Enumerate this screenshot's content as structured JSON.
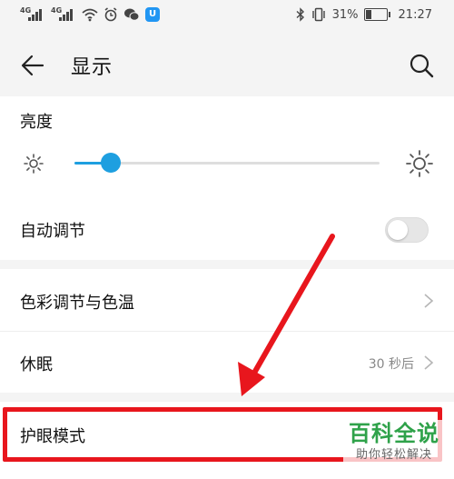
{
  "status_bar": {
    "network_1": "4G",
    "network_2": "4G",
    "battery_percent_text": "31%",
    "battery_level": 0.31,
    "time": "21:27",
    "badge": "U",
    "icons": [
      "signal-icon",
      "wifi-icon",
      "alarm-icon",
      "wechat-icon",
      "bluetooth-icon",
      "vibrate-icon",
      "battery-icon"
    ]
  },
  "header": {
    "title": "显示",
    "back_icon": "arrow-left-icon",
    "search_icon": "search-icon"
  },
  "brightness": {
    "label": "亮度",
    "level": 0.12,
    "icons": [
      "sun-small-icon",
      "sun-large-icon"
    ]
  },
  "auto_adjust": {
    "label": "自动调节",
    "enabled": false
  },
  "settings": [
    {
      "label": "色彩调节与色温",
      "value": ""
    },
    {
      "label": "休眠",
      "value": "30 秒后"
    }
  ],
  "eye_comfort": {
    "label": "护眼模式"
  },
  "annotation": {
    "color": "#e8161d"
  },
  "watermark": {
    "title": "百科全说",
    "subtitle": "助你轻松解决",
    "color": "#2fa24a"
  },
  "colors": {
    "accent": "#1e9fe0",
    "background": "#f4f4f4",
    "card": "#ffffff"
  }
}
